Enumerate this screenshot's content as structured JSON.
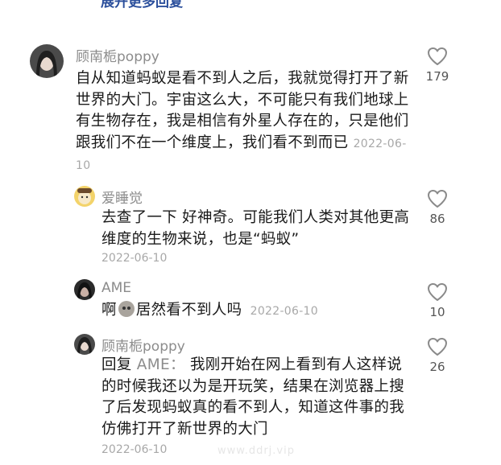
{
  "expand_more_replies": "展开更多回复",
  "comments": [
    {
      "username": "顾南栀poppy",
      "text": "自从知道蚂蚁是看不到人之后，我就觉得打开了新世界的大门。宇宙这么大，不可能只有我们地球上有生物存在，我是相信有外星人存在的，只是他们跟我们不在一个维度上，我们看不到而已",
      "date": "2022-06-10",
      "likes": "179"
    },
    {
      "username": "爱睡觉",
      "text": "去查了一下 好神奇。可能我们人类对其他更高维度的生物来说，也是“蚂蚁”",
      "date": "2022-06-10",
      "likes": "86"
    },
    {
      "username": "AME",
      "text_before": "啊",
      "text_after": "居然看不到人吗",
      "date": "2022-06-10",
      "likes": "10"
    },
    {
      "username": "顾南栀poppy",
      "reply_prefix": "回复",
      "reply_target": "AME：",
      "text": "我刚开始在网上看到有人这样说的时候我还以为是开玩笑，结果在浏览器上搜了后发现蚂蚁真的看不到人，知道这件事的我仿佛打开了新世界的大门",
      "date": "2022-06-10",
      "likes": "26"
    }
  ],
  "watermark": "www.ddrj.vip",
  "icons": {
    "like": "heart-outline-icon",
    "emoji": "face-emoji-icon"
  },
  "colors": {
    "link": "#2b4f9c",
    "username": "#8c8c8c",
    "date": "#a8a8a8"
  }
}
